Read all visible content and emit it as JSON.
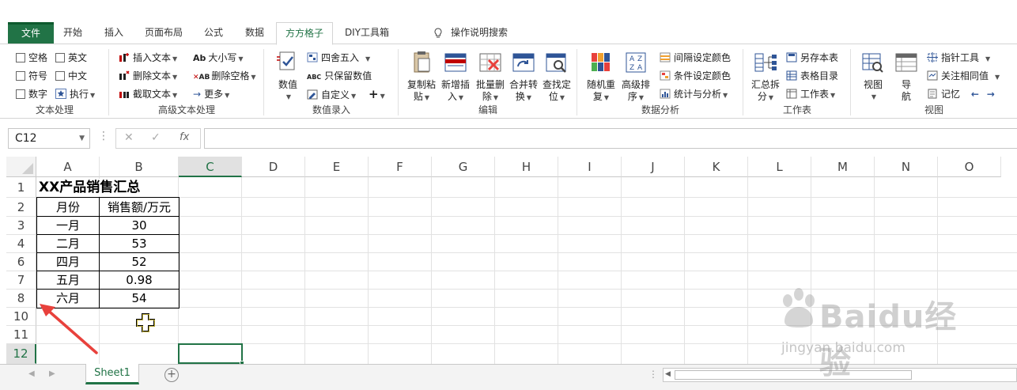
{
  "tabs": [
    {
      "label": "文件"
    },
    {
      "label": "开始"
    },
    {
      "label": "插入"
    },
    {
      "label": "页面布局"
    },
    {
      "label": "公式"
    },
    {
      "label": "数据"
    },
    {
      "label": "方方格子"
    },
    {
      "label": "DIY工具箱"
    }
  ],
  "search_tab": "操作说明搜索",
  "ribbon": {
    "text_processing": {
      "label": "文本处理",
      "checkboxes": [
        "空格",
        "英文",
        "符号",
        "中文",
        "数字"
      ],
      "execute": "执行"
    },
    "advanced_text": {
      "label": "高级文本处理",
      "items": [
        "插入文本",
        "删除文本",
        "截取文本",
        "大小写",
        "删除空格",
        "更多"
      ]
    },
    "value_entry": {
      "label": "数值录入",
      "value_btn": "数值",
      "items": [
        "四舍五入",
        "只保留数值",
        "自定义"
      ]
    },
    "edit": {
      "label": "编辑",
      "buttons": [
        "复制粘",
        "贴",
        "新增插",
        "入",
        "批量删",
        "除",
        "合并转",
        "换",
        "查找定",
        "位"
      ]
    },
    "data_analysis": {
      "label": "数据分析",
      "buttons": [
        "随机重",
        "复",
        "高级排",
        "序"
      ],
      "items": [
        "间隔设定颜色",
        "条件设定颜色",
        "统计与分析"
      ]
    },
    "worksheet": {
      "label": "工作表",
      "summary_btn": [
        "汇总拆",
        "分"
      ],
      "items": [
        "另存本表",
        "表格目录",
        "工作表"
      ]
    },
    "view": {
      "label": "视图",
      "buttons": [
        "视图",
        "导",
        "航"
      ],
      "items": [
        "指针工具",
        "关注相同值",
        "记忆"
      ]
    }
  },
  "formula_bar": {
    "name_box": "C12",
    "fx": "fx",
    "formula": ""
  },
  "columns": [
    "A",
    "B",
    "C",
    "D",
    "E",
    "F",
    "G",
    "H",
    "I",
    "J",
    "K",
    "L",
    "M",
    "N",
    "O"
  ],
  "rows": [
    "1",
    "2",
    "3",
    "4",
    "6",
    "7",
    "8",
    "10",
    "11",
    "12"
  ],
  "sheet": {
    "title": "XX产品销售汇总",
    "headers": [
      "月份",
      "销售额/万元"
    ],
    "data": [
      [
        "一月",
        "30"
      ],
      [
        "二月",
        "53"
      ],
      [
        "四月",
        "52"
      ],
      [
        "五月",
        "0.98"
      ],
      [
        "六月",
        "54"
      ]
    ]
  },
  "selected_cell": "C12",
  "sheet_tabs": [
    {
      "label": "Sheet1"
    }
  ],
  "watermark": {
    "text": "Baidu经验",
    "url": "jingyan.baidu.com"
  },
  "colors": {
    "excel_green": "#217346",
    "arrow_red": "#e8413c"
  }
}
